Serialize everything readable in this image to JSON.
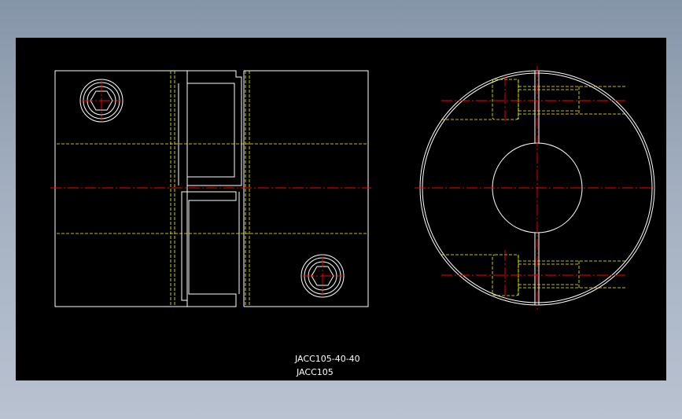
{
  "drawing": {
    "labels": {
      "model": "JACC105-40-40",
      "series": "JACC105"
    },
    "colors": {
      "background": "#000000",
      "outline": "#ffffff",
      "hidden_line": "#ffff00",
      "center_line": "#ff0000",
      "frame_bg": "#94a3b8"
    }
  }
}
